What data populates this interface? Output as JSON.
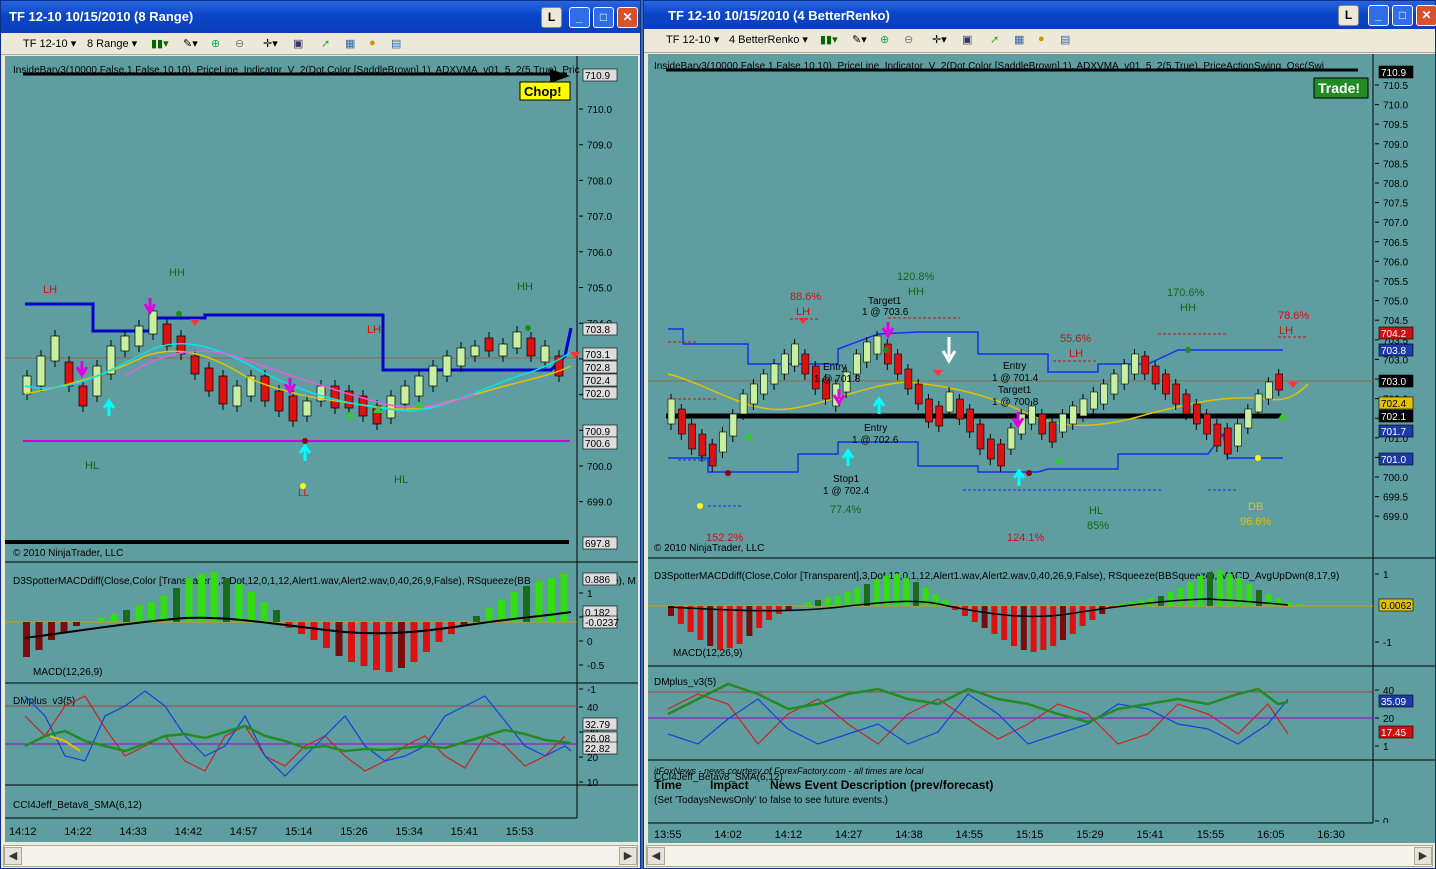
{
  "left": {
    "title": "TF 12-10  10/15/2010 (8 Range)",
    "toolbar": {
      "instrument": "TF 12-10",
      "period": "8 Range"
    },
    "indicator_header": "InsideBarv3(10000,False,1,False,10,10), PriceLine_Indicator_V_2(Dot,Color [SaddleBrown],1),  ADXVMA_v01_5_2(5,True), Pric",
    "copyright": "© 2010 NinjaTrader, LLC",
    "badge": "Chop!",
    "price_ticks": [
      "710.0",
      "709.0",
      "708.0",
      "707.0",
      "706.0",
      "705.0",
      "704.0",
      "703.0",
      "702.0",
      "701.0",
      "700.0",
      "699.0"
    ],
    "price_boxes": [
      "710.9",
      "703.8",
      "703.1",
      "702.8",
      "702.4",
      "702.0",
      "700.9",
      "700.6",
      "697.8"
    ],
    "annotations": [
      "LH",
      "HH",
      "HH",
      "LH",
      "HL",
      "HL",
      "LL"
    ],
    "macd_header": "D3SpotterMACDdiff(Close,Color [Transparent],3,Dot,12,0,1,12,Alert1.wav,Alert2.wav,0,40,26,9,False), RSqueeze(BB",
    "macd_sub": "MACD(12,26,9)",
    "macd_suffix": "e), M",
    "macd_ticks": [
      "1",
      "0.5",
      "0",
      "-0.5",
      "-1"
    ],
    "macd_boxes": [
      "0.886",
      "0.182",
      "-0.0237"
    ],
    "dm_header": "DMplus_v3(5)",
    "dm_ticks": [
      "40",
      "30",
      "20",
      "10"
    ],
    "dm_boxes": [
      "32.79",
      "26.08",
      "22.82"
    ],
    "cci_header": "CCI4Jeff_Betav8_SMA(6,12)",
    "time_labels": [
      "14:12",
      "14:22",
      "14:33",
      "14:42",
      "14:57",
      "15:14",
      "15:26",
      "15:34",
      "15:41",
      "15:53"
    ]
  },
  "right": {
    "title": "TF 12-10  10/15/2010 (4 BetterRenko)",
    "toolbar": {
      "instrument": "TF 12-10",
      "period": "4 BetterRenko"
    },
    "indicator_header": "InsideBarv3(10000,False,1,False,10,10), PriceLine_Indicator_V_2(Dot,Color [SaddleBrown],1),  ADXVMA_v01_5_2(5,True), PriceActionSwing_Osc(Swi",
    "copyright": "© 2010 NinjaTrader, LLC",
    "badge": "Trade!",
    "price_ticks": [
      "710.5",
      "710.0",
      "709.5",
      "709.0",
      "708.5",
      "708.0",
      "707.5",
      "707.0",
      "706.5",
      "706.0",
      "705.5",
      "705.0",
      "704.5",
      "703.5",
      "703.0",
      "702.5",
      "702.0",
      "701.5",
      "701.0",
      "700.5",
      "700.0",
      "699.5",
      "699.0"
    ],
    "price_boxes": [
      "710.9",
      "704.2",
      "703.8",
      "703.0",
      "702.4",
      "702.1",
      "701.7",
      "701.0"
    ],
    "annotations": {
      "pct_88": "88.6%",
      "lh1": "LH",
      "pct_120": "120.8%",
      "hh1": "HH",
      "pct_55": "55.6%",
      "lh2": "LH",
      "pct_170": "170.6%",
      "hh2": "HH",
      "pct_78": "78.6%",
      "lh3": "LH",
      "pct_152": "152.2%",
      "pct_77": "77.4%",
      "hl": "HL",
      "pct_85": "85%",
      "pct_124": "124.1%",
      "db": "DB",
      "pct_96": "96.6%",
      "target1a": "Target1",
      "target1a_v": "1 @ 703.6",
      "entry1": "Entry",
      "entry1_v": "1 @ 701.8",
      "entry2": "Entry",
      "entry2_v": "1 @ 702.6",
      "stop1": "Stop1",
      "stop1_v": "1 @ 702.4",
      "entry3": "Entry",
      "entry3_v": "1 @ 701.4",
      "target1b": "Target1",
      "target1b_v": "1 @ 700.8"
    },
    "macd_header": "D3SpotterMACDdiff(Close,Color [Transparent],3,Dot,12,0,1,12,Alert1.wav,Alert2.wav,0,40,26,9,False), RSqueeze(BBSqueeze), MACD_AvgUpDwn(8,17,9)",
    "macd_sub": "MACD(12,26,9)",
    "macd_ticks": [
      "1",
      "-1"
    ],
    "macd_boxes": [
      "0.0062"
    ],
    "dm_header": "DMplus_v3(5)",
    "dm_ticks": [
      "40",
      "20",
      "1"
    ],
    "dm_boxes": [
      "35.09",
      "17.45"
    ],
    "cci_header": "CCI4Jeff_Betav8_SMA(6,12)",
    "cci_ticks": [
      "0"
    ],
    "news": {
      "credit": "itFoxNews - news courtesy of ForexFactory.com - all times are local",
      "col_time": "Time",
      "col_impact": "Impact",
      "col_desc": "News Event Description (prev/forecast)",
      "note": "(Set 'TodaysNewsOnly' to false to see future events.)"
    },
    "time_labels": [
      "13:55",
      "14:02",
      "14:12",
      "14:27",
      "14:38",
      "14:55",
      "15:15",
      "15:29",
      "15:41",
      "15:55",
      "16:05",
      "16:30"
    ]
  },
  "colors": {
    "chart_bg": "#5f9ea0",
    "title_bar": "#0a46c8",
    "bull": "#c8f0a0",
    "bear": "#dd1111",
    "macd_up": "#33dd11",
    "macd_dn": "#dd1111"
  }
}
